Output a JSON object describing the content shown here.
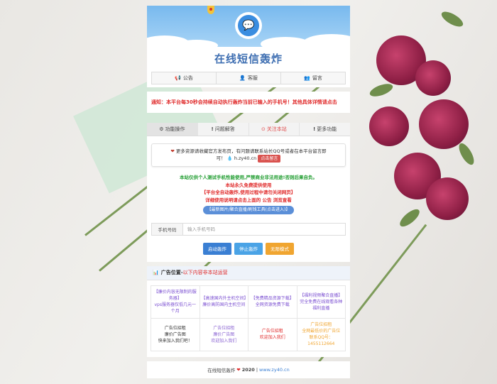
{
  "site": {
    "title": "在线短信轰炸"
  },
  "top_nav": [
    {
      "icon": "megaphone-icon",
      "label": "公告"
    },
    {
      "icon": "user-icon",
      "label": "客服"
    },
    {
      "icon": "users-icon",
      "label": "留言"
    }
  ],
  "notice": "通知：本平台每30秒会持续自动执行轰炸当前已输入的手机号！其他具体详情请点击",
  "tabs": [
    {
      "label": "功能操作",
      "icon": "gear-icon",
      "active": true
    },
    {
      "label": "问题解答",
      "icon": "exclamation-icon"
    },
    {
      "label": "关注本站",
      "icon": "heart-circle-icon"
    },
    {
      "label": "更多功能",
      "icon": "exclamation-icon"
    }
  ],
  "info": {
    "line1": "更多资源请收藏官方发布页，有问题请联系站长QQ号或者在本平台留言即",
    "line2_prefix": "可！",
    "url": "h.zy40.cn",
    "qq_button": "点击留言"
  },
  "lines": {
    "l1": "本站仅供个人测试手机性能使用,严禁商业非法用途!否则后果自负。",
    "l2": "本站永久免费提供使用",
    "l3": "【平台全自动轰炸,使用过程中请勿关闭网页】",
    "l4": "详细使用说明请点击上面的 公告 浏览查看",
    "pill": "【最新图片/聚合直播/刷钱工具(点击进入)】"
  },
  "phone": {
    "label": "手机号码",
    "placeholder": "输入手机号码"
  },
  "buttons": {
    "start": "启动轰炸",
    "stop": "停止轰炸",
    "unlimited": "无限模式"
  },
  "ads": {
    "head_title": "广告位置-",
    "head_red": "以下内容非本站运营",
    "cells": [
      {
        "lines": [
          "【廉价内容无限制的服务器】",
          "vps服务器仅低几元一个月"
        ],
        "cls": "purple"
      },
      {
        "lines": [
          "【高速国内外主机空间】",
          "廉价高防国内主机空间"
        ],
        "cls": "purple"
      },
      {
        "lines": [
          "【免费精品资源下载】",
          "全网资源免费下载"
        ],
        "cls": "purple"
      },
      {
        "lines": [
          "【福利视频聚合直播】",
          "完全免费在线观看各种福利直播"
        ],
        "cls": "purple"
      },
      {
        "lines": [
          "广告位招租",
          "廉价广告图",
          "快来加入我们吧！"
        ],
        "cls": "dark"
      },
      {
        "lines": [
          "广告位招租",
          "廉价广告图",
          "欢迎加入我们"
        ],
        "cls": "gray-p"
      },
      {
        "lines": [
          "广告位招租",
          "欢迎加入我们"
        ],
        "cls": "red"
      },
      {
        "lines": [
          "广告位招租",
          "全网最低价的广告位",
          "联系QQ号：1455112664"
        ],
        "cls": "orange"
      }
    ]
  },
  "footer": {
    "left": "在线短信轰炸",
    "year": "2020",
    "sep": "|",
    "link": "www.zy40.cn"
  }
}
